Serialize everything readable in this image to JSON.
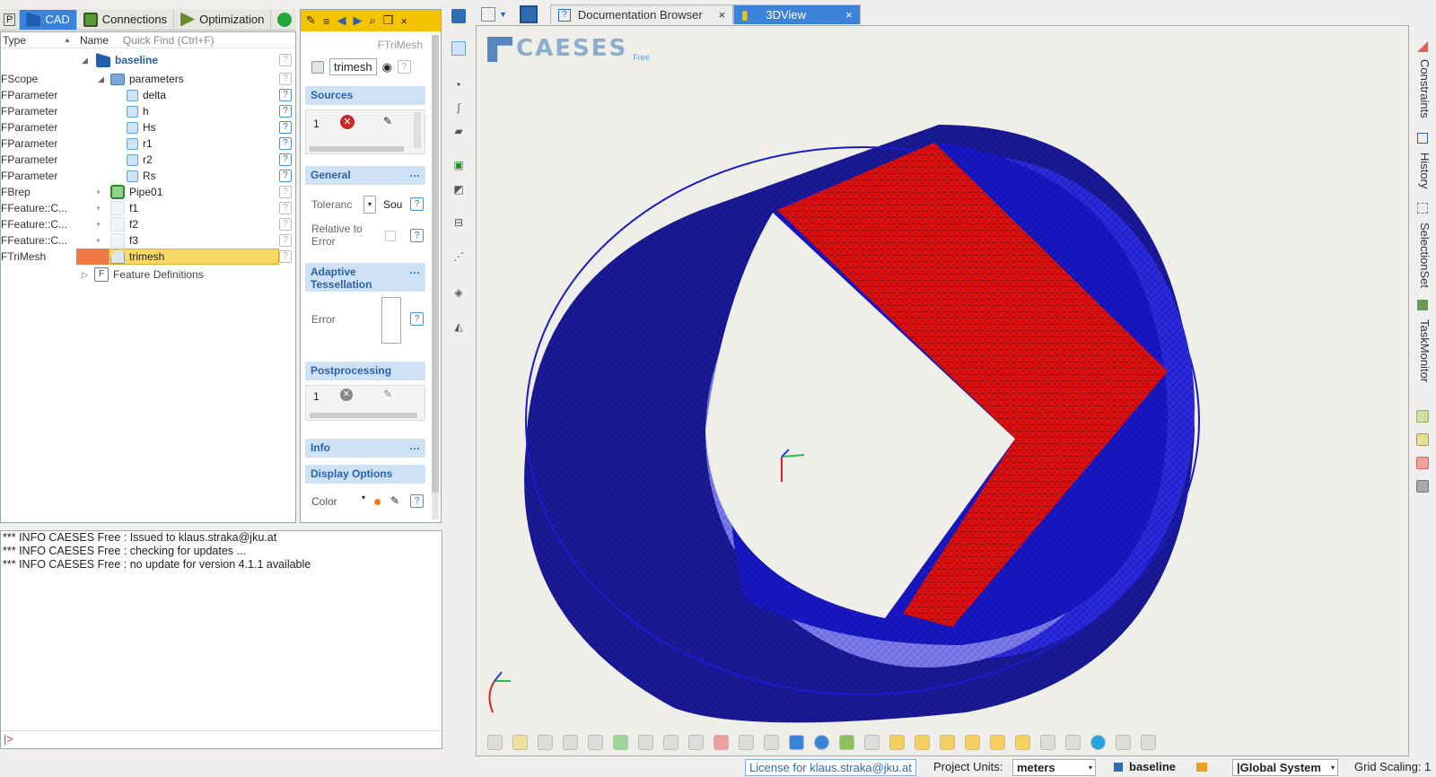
{
  "left_tabs": [
    {
      "label": "P"
    },
    {
      "label": "CAD"
    },
    {
      "label": "Connections"
    },
    {
      "label": "Optimization"
    }
  ],
  "tree": {
    "col_type": "Type",
    "col_name": "Name",
    "quick_find_placeholder": "Quick Find (Ctrl+F)",
    "rows": [
      {
        "type": "",
        "name": "baseline"
      },
      {
        "type": "FScope",
        "name": "parameters"
      },
      {
        "type": "FParameter",
        "name": "delta"
      },
      {
        "type": "FParameter",
        "name": "h"
      },
      {
        "type": "FParameter",
        "name": "Hs"
      },
      {
        "type": "FParameter",
        "name": "r1"
      },
      {
        "type": "FParameter",
        "name": "r2"
      },
      {
        "type": "FParameter",
        "name": "Rs"
      },
      {
        "type": "FBrep",
        "name": "Pipe01"
      },
      {
        "type": "FFeature::C...",
        "name": "f1"
      },
      {
        "type": "FFeature::C...",
        "name": "f2"
      },
      {
        "type": "FFeature::C...",
        "name": "f3"
      },
      {
        "type": "FTriMesh",
        "name": "trimesh"
      },
      {
        "type": "",
        "name": "Feature Definitions"
      }
    ]
  },
  "props": {
    "type_label": "FTriMesh",
    "object_name": "trimesh",
    "sections": {
      "sources": "Sources",
      "general": "General",
      "adaptive": "Adaptive Tessellation",
      "postprocessing": "Postprocessing",
      "info": "Info",
      "display": "Display Options"
    },
    "sources_index": "1",
    "tolerance_label": "Toleranc",
    "tolerance_value": "Sou",
    "relative_label": "Relative to Error",
    "error_label": "Error",
    "post_index": "1",
    "color_label": "Color"
  },
  "console": {
    "lines": [
      "*** INFO CAESES Free : Issued to klaus.straka@jku.at",
      "*** INFO CAESES Free : checking for updates ...",
      "*** INFO CAESES Free : no update for version 4.1.1 available"
    ],
    "prompt": "|>"
  },
  "view_tabs": [
    {
      "label": "Documentation Browser"
    },
    {
      "label": "3DView"
    }
  ],
  "logo": {
    "text": "CAESES",
    "edition": "Free"
  },
  "right_panel": [
    "Constraints",
    "History",
    "SelectionSet",
    "TaskMonitor"
  ],
  "status": {
    "license": "License for klaus.straka@jku.at",
    "units_label": "Project Units:",
    "units_value": "meters",
    "design": "baseline",
    "coord_system": "|Global System",
    "grid_scaling": "Grid Scaling: 1"
  },
  "colors": {
    "accent": "#3b83d8",
    "selection": "#f8d867",
    "mesh_blue": "#1a1ad0",
    "mesh_red": "#e01010",
    "toolbar_yellow": "#f5c400"
  }
}
